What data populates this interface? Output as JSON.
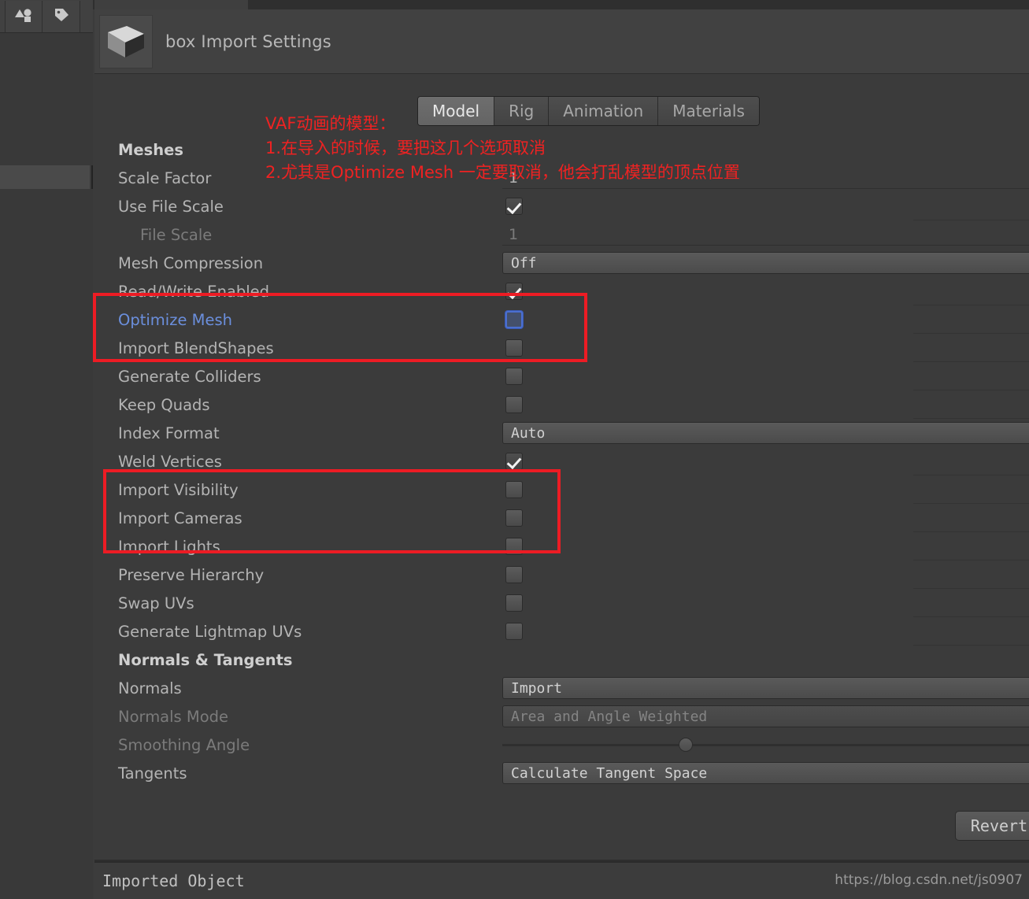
{
  "window": {
    "tab_label": "",
    "title": "box Import Settings",
    "thumbnail_icon": "cube-mesh-thumbnail"
  },
  "toolbar": {
    "buttons": [
      {
        "name": "shapes-icon",
        "label": ""
      },
      {
        "name": "tag-icon",
        "label": ""
      }
    ]
  },
  "tabs": [
    {
      "label": "Model",
      "active": true
    },
    {
      "label": "Rig",
      "active": false
    },
    {
      "label": "Animation",
      "active": false
    },
    {
      "label": "Materials",
      "active": false
    }
  ],
  "annotation": {
    "color": "#ef2222",
    "lines": [
      "VAF动画的模型：",
      "1.在导入的时候，要把这几个选项取消",
      "2.尤其是Optimize Mesh 一定要取消，他会打乱模型的顶点位置"
    ]
  },
  "sections": [
    {
      "header": "Meshes",
      "rows": [
        {
          "label": "Scale Factor",
          "type": "number",
          "value": "1",
          "dim": false,
          "indent": false
        },
        {
          "label": "Use File Scale",
          "type": "checkbox",
          "value": "checked",
          "dim": false,
          "indent": false
        },
        {
          "label": "File Scale",
          "type": "number",
          "value": "1",
          "dim": true,
          "indent": true
        },
        {
          "label": "Mesh Compression",
          "type": "popup",
          "value": "Off",
          "dim": false,
          "indent": false
        },
        {
          "label": "Read/Write Enabled",
          "type": "checkbox",
          "value": "checked",
          "dim": false,
          "indent": false
        },
        {
          "label": "Optimize Mesh",
          "type": "checkbox",
          "value": "unchecked",
          "dim": false,
          "indent": false,
          "highlight": "blue"
        },
        {
          "label": "Import BlendShapes",
          "type": "checkbox",
          "value": "unchecked",
          "dim": false,
          "indent": false
        },
        {
          "label": "Generate Colliders",
          "type": "checkbox",
          "value": "unchecked",
          "dim": false,
          "indent": false
        },
        {
          "label": "Keep Quads",
          "type": "checkbox",
          "value": "unchecked",
          "dim": false,
          "indent": false
        },
        {
          "label": "Index Format",
          "type": "popup",
          "value": "Auto",
          "dim": false,
          "indent": false
        },
        {
          "label": "Weld Vertices",
          "type": "checkbox",
          "value": "checked",
          "dim": false,
          "indent": false
        },
        {
          "label": "Import Visibility",
          "type": "checkbox",
          "value": "unchecked",
          "dim": false,
          "indent": false
        },
        {
          "label": "Import Cameras",
          "type": "checkbox",
          "value": "unchecked",
          "dim": false,
          "indent": false
        },
        {
          "label": "Import Lights",
          "type": "checkbox",
          "value": "unchecked",
          "dim": false,
          "indent": false
        },
        {
          "label": "Preserve Hierarchy",
          "type": "checkbox",
          "value": "unchecked",
          "dim": false,
          "indent": false
        },
        {
          "label": "Swap UVs",
          "type": "checkbox",
          "value": "unchecked",
          "dim": false,
          "indent": false
        },
        {
          "label": "Generate Lightmap UVs",
          "type": "checkbox",
          "value": "unchecked",
          "dim": false,
          "indent": false
        }
      ]
    },
    {
      "header": "Normals & Tangents",
      "rows": [
        {
          "label": "Normals",
          "type": "popup",
          "value": "Import",
          "dim": false,
          "indent": false
        },
        {
          "label": "Normals Mode",
          "type": "popup",
          "value": "Area and Angle Weighted",
          "dim": true,
          "indent": false
        },
        {
          "label": "Smoothing Angle",
          "type": "slider",
          "value": "",
          "dim": true,
          "indent": false
        },
        {
          "label": "Tangents",
          "type": "popup",
          "value": "Calculate Tangent Space",
          "dim": false,
          "indent": false
        }
      ]
    }
  ],
  "buttons": {
    "revert": "Revert"
  },
  "footer": {
    "label": "Imported Object",
    "watermark": "https://blog.csdn.net/js0907"
  },
  "colors": {
    "panel_bg": "#3b3b3b",
    "header_bg": "#414141",
    "text": "#b4b4b4",
    "text_dim": "#7b7b7b",
    "accent_blue": "#6b8fdd",
    "annotation_red": "#ef2222"
  }
}
